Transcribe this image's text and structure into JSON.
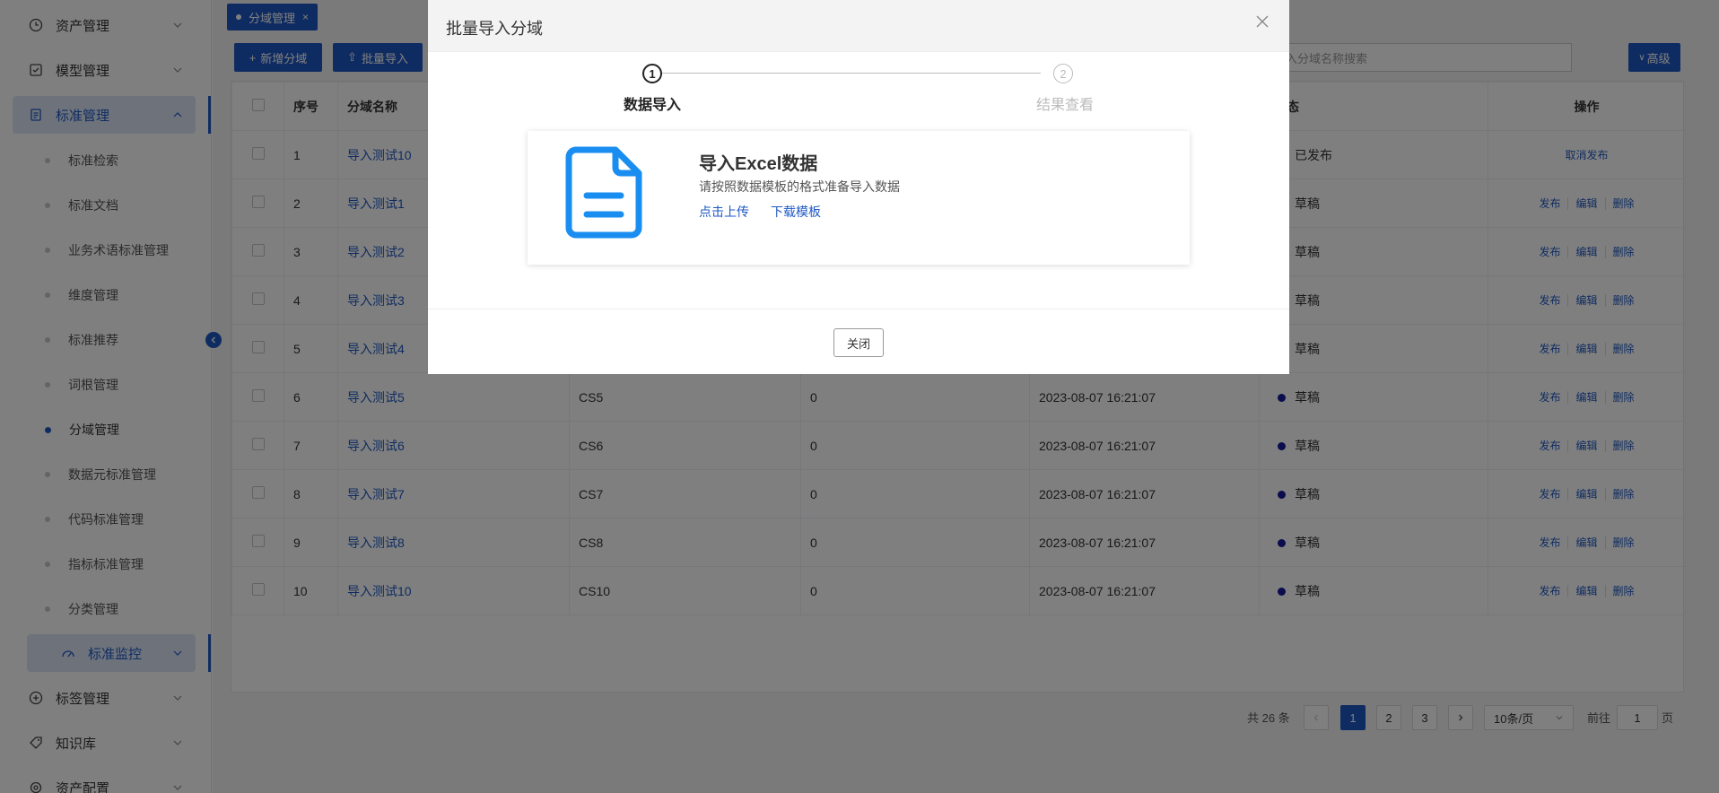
{
  "sidebar": {
    "items": [
      {
        "label": "资产管理",
        "icon": "clock-icon"
      },
      {
        "label": "模型管理",
        "icon": "checkbox-icon"
      },
      {
        "label": "标准管理",
        "icon": "document-icon"
      },
      {
        "label": "标签管理",
        "icon": "plus-circle-icon"
      },
      {
        "label": "知识库",
        "icon": "tag-icon"
      },
      {
        "label": "资产配置",
        "icon": "settings-icon"
      }
    ],
    "sub_items": [
      "标准检索",
      "标准文档",
      "业务术语标准管理",
      "维度管理",
      "标准推荐",
      "词根管理",
      "分域管理",
      "数据元标准管理",
      "代码标准管理",
      "指标标准管理",
      "分类管理"
    ],
    "monitor_label": "标准监控"
  },
  "tab": {
    "label": "分域管理",
    "close": "×"
  },
  "toolbar": {
    "add_label": "新增分域",
    "import_label": "批量导入",
    "search_placeholder": "入分域名称搜索",
    "advanced_label": "高级"
  },
  "table": {
    "headers": [
      "",
      "序号",
      "分域名称",
      "",
      "",
      "",
      "态",
      "操作"
    ],
    "rows": [
      {
        "no": "1",
        "name": "导入测试10",
        "code": "",
        "count": "",
        "time": "",
        "status": "已发布",
        "ops": [
          "取消发布"
        ]
      },
      {
        "no": "2",
        "name": "导入测试1",
        "code": "",
        "count": "",
        "time": "",
        "status": "草稿",
        "ops": [
          "发布",
          "编辑",
          "删除"
        ]
      },
      {
        "no": "3",
        "name": "导入测试2",
        "code": "",
        "count": "",
        "time": "",
        "status": "草稿",
        "ops": [
          "发布",
          "编辑",
          "删除"
        ]
      },
      {
        "no": "4",
        "name": "导入测试3",
        "code": "",
        "count": "",
        "time": "",
        "status": "草稿",
        "ops": [
          "发布",
          "编辑",
          "删除"
        ]
      },
      {
        "no": "5",
        "name": "导入测试4",
        "code": "",
        "count": "",
        "time": "",
        "status": "草稿",
        "ops": [
          "发布",
          "编辑",
          "删除"
        ]
      },
      {
        "no": "6",
        "name": "导入测试5",
        "code": "CS5",
        "count": "0",
        "time": "2023-08-07 16:21:07",
        "status": "草稿",
        "ops": [
          "发布",
          "编辑",
          "删除"
        ]
      },
      {
        "no": "7",
        "name": "导入测试6",
        "code": "CS6",
        "count": "0",
        "time": "2023-08-07 16:21:07",
        "status": "草稿",
        "ops": [
          "发布",
          "编辑",
          "删除"
        ]
      },
      {
        "no": "8",
        "name": "导入测试7",
        "code": "CS7",
        "count": "0",
        "time": "2023-08-07 16:21:07",
        "status": "草稿",
        "ops": [
          "发布",
          "编辑",
          "删除"
        ]
      },
      {
        "no": "9",
        "name": "导入测试8",
        "code": "CS8",
        "count": "0",
        "time": "2023-08-07 16:21:07",
        "status": "草稿",
        "ops": [
          "发布",
          "编辑",
          "删除"
        ]
      },
      {
        "no": "10",
        "name": "导入测试10",
        "code": "CS10",
        "count": "0",
        "time": "2023-08-07 16:21:07",
        "status": "草稿",
        "ops": [
          "发布",
          "编辑",
          "删除"
        ]
      }
    ]
  },
  "pagination": {
    "total": "共 26 条",
    "pages": [
      "1",
      "2",
      "3"
    ],
    "current": "1",
    "page_size": "10条/页",
    "goto_prefix": "前往",
    "goto_value": "1",
    "goto_suffix": "页"
  },
  "modal": {
    "title": "批量导入分域",
    "steps": [
      {
        "num": "1",
        "label": "数据导入"
      },
      {
        "num": "2",
        "label": "结果查看"
      }
    ],
    "card_title": "导入Excel数据",
    "card_desc": "请按照数据模板的格式准备导入数据",
    "upload_label": "点击上传",
    "template_label": "下载模板",
    "close_label": "关闭"
  },
  "colors": {
    "primary": "#1f59c4",
    "status_dot": "#13199a",
    "overlay": "rgba(0,0,0,0.5)"
  }
}
